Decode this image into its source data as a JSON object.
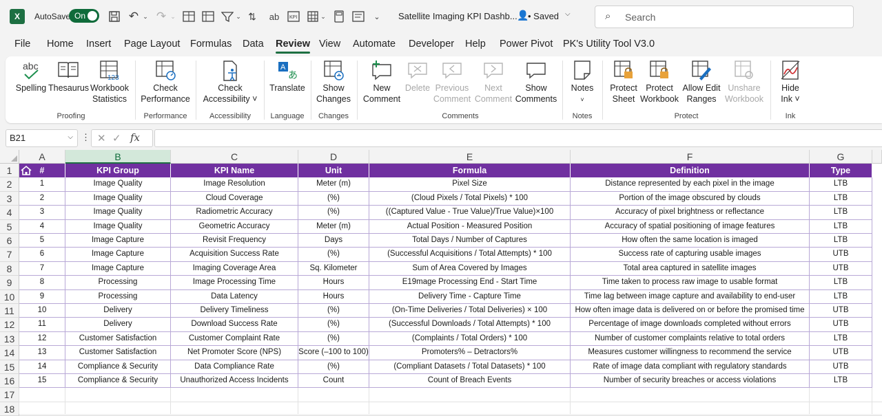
{
  "titlebar": {
    "app_logo": "X",
    "autosave_label": "AutoSave",
    "autosave_toggle": "On",
    "doc_title": "Satellite Imaging KPI Dashb...",
    "saved_status": "• Saved",
    "search_placeholder": "Search",
    "icons": [
      "save-icon",
      "undo-icon",
      "redo-icon",
      "table-icon",
      "freeze-panes-icon",
      "filter-icon",
      "spelling-icon",
      "kpi-icon",
      "calculator-icon",
      "form-icon",
      "customize-icon"
    ]
  },
  "menu": {
    "tabs": [
      {
        "label": "File"
      },
      {
        "label": "Home"
      },
      {
        "label": "Insert"
      },
      {
        "label": "Page Layout"
      },
      {
        "label": "Formulas"
      },
      {
        "label": "Data"
      },
      {
        "label": "Review",
        "active": true
      },
      {
        "label": "View"
      },
      {
        "label": "Automate"
      },
      {
        "label": "Developer"
      },
      {
        "label": "Help"
      },
      {
        "label": "Power Pivot"
      },
      {
        "label": "PK's Utility Tool V3.0"
      }
    ]
  },
  "ribbon": {
    "buttons": {
      "spelling": "Spelling",
      "thesaurus": "Thesaurus",
      "workbook_statistics_1": "Workbook",
      "workbook_statistics_2": "Statistics",
      "check_performance_1": "Check",
      "check_performance_2": "Performance",
      "check_accessibility_1": "Check",
      "check_accessibility_2": "Accessibility ˅",
      "translate": "Translate",
      "show_changes_1": "Show",
      "show_changes_2": "Changes",
      "new_comment_1": "New",
      "new_comment_2": "Comment",
      "delete": "Delete",
      "previous_comment_1": "Previous",
      "previous_comment_2": "Comment",
      "next_comment_1": "Next",
      "next_comment_2": "Comment",
      "show_comments_1": "Show",
      "show_comments_2": "Comments",
      "notes": "Notes",
      "protect_sheet_1": "Protect",
      "protect_sheet_2": "Sheet",
      "protect_workbook_1": "Protect",
      "protect_workbook_2": "Workbook",
      "allow_edit_ranges_1": "Allow Edit",
      "allow_edit_ranges_2": "Ranges",
      "unshare_workbook_1": "Unshare",
      "unshare_workbook_2": "Workbook",
      "hide_ink_1": "Hide",
      "hide_ink_2": "Ink ˅"
    },
    "groups": {
      "proofing": "Proofing",
      "performance": "Performance",
      "accessibility": "Accessibility",
      "language": "Language",
      "changes": "Changes",
      "comments": "Comments",
      "notes": "Notes",
      "protect": "Protect",
      "ink": "Ink"
    }
  },
  "formula_bar": {
    "name_box": "B21",
    "fx": "fx",
    "formula": ""
  },
  "sheet": {
    "columns": [
      "A",
      "B",
      "C",
      "D",
      "E",
      "F",
      "G"
    ],
    "selected_column": "B",
    "row_numbers": [
      "1",
      "2",
      "3",
      "4",
      "5",
      "6",
      "7",
      "8",
      "9",
      "10",
      "11",
      "12",
      "13",
      "14",
      "15",
      "16",
      "17",
      "18"
    ],
    "headers": [
      "#",
      "KPI Group",
      "KPI Name",
      "Unit",
      "Formula",
      "Definition",
      "Type"
    ],
    "rows": [
      [
        "1",
        "Image Quality",
        "Image Resolution",
        "Meter (m)",
        "Pixel Size",
        "Distance represented by each pixel in the image",
        "LTB"
      ],
      [
        "2",
        "Image Quality",
        "Cloud Coverage",
        "(%)",
        "(Cloud Pixels / Total Pixels) * 100",
        "Portion of the image obscured by clouds",
        "LTB"
      ],
      [
        "3",
        "Image Quality",
        "Radiometric Accuracy",
        "(%)",
        "((Captured Value - True Value)/True Value)×100",
        "Accuracy of pixel brightness or reflectance",
        "LTB"
      ],
      [
        "4",
        "Image Quality",
        "Geometric Accuracy",
        "Meter (m)",
        "Actual Position - Measured Position",
        "Accuracy of spatial positioning of image features",
        "LTB"
      ],
      [
        "5",
        "Image Capture",
        "Revisit Frequency",
        "Days",
        "Total Days / Number of Captures",
        "How often the same location is imaged",
        "LTB"
      ],
      [
        "6",
        "Image Capture",
        "Acquisition Success Rate",
        "(%)",
        "(Successful Acquisitions / Total Attempts) * 100",
        "Success rate of capturing usable images",
        "UTB"
      ],
      [
        "7",
        "Image Capture",
        "Imaging Coverage Area",
        "Sq. Kilometer",
        "Sum of Area Covered by Images",
        "Total area captured in satellite images",
        "UTB"
      ],
      [
        "8",
        "Processing",
        "Image Processing Time",
        "Hours",
        "E19mage Processing End - Start Time",
        "Time taken to process raw image to usable format",
        "LTB"
      ],
      [
        "9",
        "Processing",
        "Data Latency",
        "Hours",
        "Delivery Time - Capture Time",
        "Time lag between image capture and availability to end-user",
        "LTB"
      ],
      [
        "10",
        "Delivery",
        "Delivery Timeliness",
        "(%)",
        "(On-Time Deliveries / Total Deliveries) × 100",
        "How often image data is delivered on or before the promised time",
        "UTB"
      ],
      [
        "11",
        "Delivery",
        "Download Success Rate",
        "(%)",
        "(Successful Downloads / Total Attempts) * 100",
        "Percentage of image downloads completed without errors",
        "UTB"
      ],
      [
        "12",
        "Customer Satisfaction",
        "Customer Complaint Rate",
        "(%)",
        "(Complaints / Total Orders) * 100",
        "Number of customer complaints relative to total orders",
        "LTB"
      ],
      [
        "13",
        "Customer Satisfaction",
        "Net Promoter Score (NPS)",
        "Score (–100 to 100)",
        "Promoters% – Detractors%",
        "Measures customer willingness to recommend the service",
        "UTB"
      ],
      [
        "14",
        "Compliance & Security",
        "Data Compliance Rate",
        "(%)",
        "(Compliant Datasets / Total Datasets) * 100",
        "Rate of image data compliant with regulatory standards",
        "UTB"
      ],
      [
        "15",
        "Compliance & Security",
        "Unauthorized Access Incidents",
        "Count",
        "Count of Breach Events",
        "Number of security breaches or access violations",
        "LTB"
      ]
    ]
  }
}
